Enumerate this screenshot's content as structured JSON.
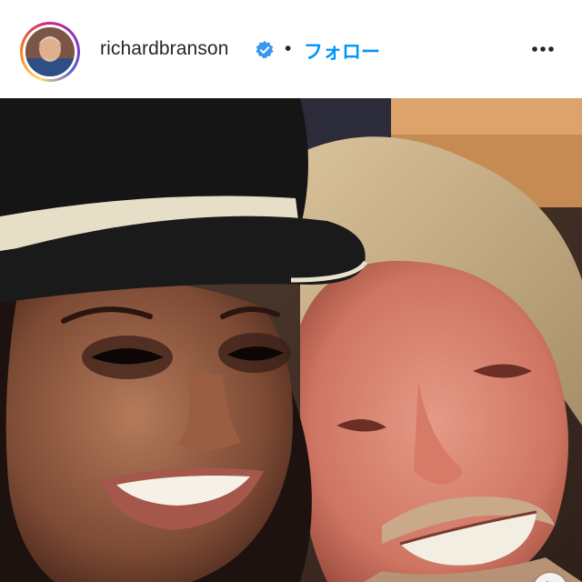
{
  "header": {
    "username": "richardbranson",
    "separator": "•",
    "follow_label": "フォロー"
  },
  "icons": {
    "verified": "verified-badge-icon",
    "more": "more-options-icon",
    "next": "chevron-right-icon"
  },
  "colors": {
    "follow_blue": "#0095f6",
    "verified_blue": "#3897f0",
    "text": "#262626"
  }
}
